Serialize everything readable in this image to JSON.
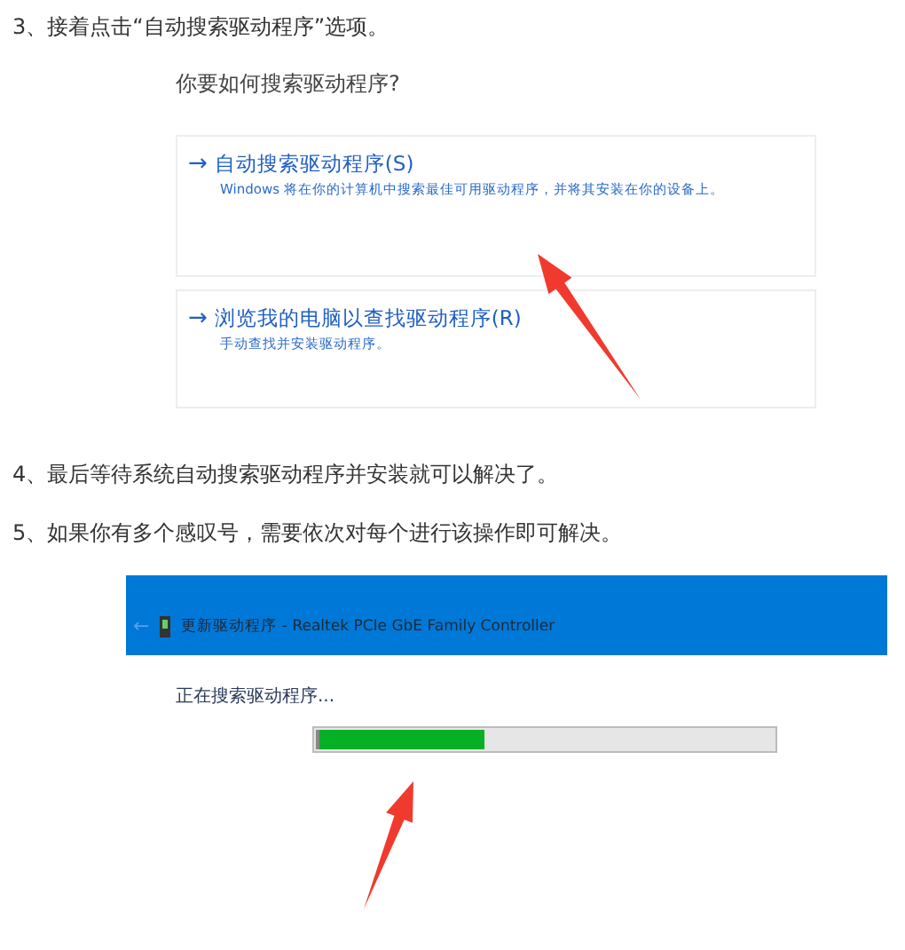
{
  "steps": [
    {
      "kind": "text",
      "text": "3、接着点击“自动搜索驱动程序”选项。"
    },
    {
      "kind": "search_dialog",
      "question": "你要如何搜索驱动程序?",
      "options": [
        {
          "arrow": "→",
          "title": "自动搜索驱动程序(S)",
          "description": "Windows 将在你的计算机中搜索最佳可用驱动程序，并将其安装在你的设备上。",
          "pointed": true
        },
        {
          "arrow": "→",
          "title": "浏览我的电脑以查找驱动程序(R)",
          "description": "手动查找并安装驱动程序。",
          "pointed": false
        }
      ]
    },
    {
      "kind": "text",
      "text": "4、最后等待系统自动搜索驱动程序并安装就可以解决了。"
    },
    {
      "kind": "text",
      "text": "5、如果你有多个感叹号，需要依次对每个进行该操作即可解决。"
    },
    {
      "kind": "progress_dialog",
      "back": "←",
      "title": "更新驱动程序 - Realtek PCIe GbE Family Controller",
      "status": "正在搜索驱动程序...",
      "level": 0.37
    }
  ]
}
